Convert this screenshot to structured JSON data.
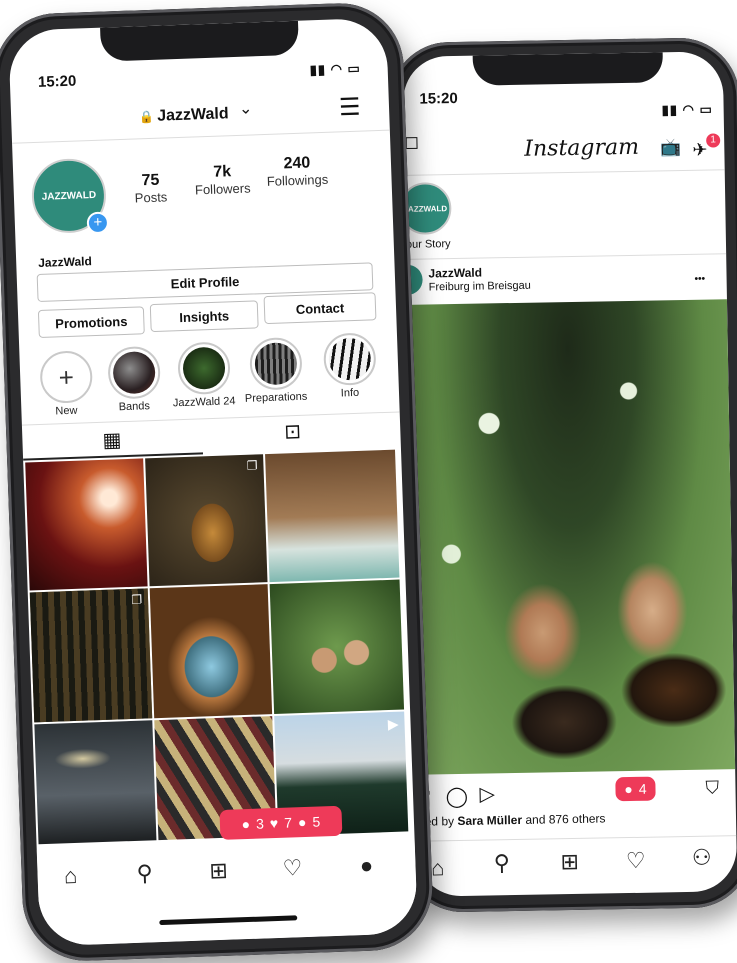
{
  "left_phone": {
    "status_time": "15:20",
    "status_icons": "▮▮▮ ◠ ▭",
    "account": "JazzWald",
    "account_chevron": "⌄",
    "menu_icon": "☰",
    "avatar_text": "JAZZWALD",
    "stats": [
      {
        "value": "75",
        "label": "Posts"
      },
      {
        "value": "7k",
        "label": "Followers"
      },
      {
        "value": "240",
        "label": "Followings"
      }
    ],
    "profile_name": "JazzWald",
    "edit_profile": "Edit Profile",
    "buttons": [
      "Promotions",
      "Insights",
      "Contact"
    ],
    "highlights": [
      "New",
      "Bands",
      "JazzWald 24",
      "Preparations",
      "Info"
    ],
    "notification": {
      "comments": "3",
      "likes": "7",
      "follows": "5"
    },
    "nav_icons": [
      "home-icon",
      "search-icon",
      "add-icon",
      "heart-icon",
      "profile-icon"
    ]
  },
  "right_phone": {
    "status_time": "15:20",
    "app_title": "Instagram",
    "dm_badge": "1",
    "story_label": "our Story",
    "story_avatar_text": "JAZZWALD",
    "post_user": "JazzWald",
    "post_location": "Freiburg im Breisgau",
    "post_more": "•••",
    "comment_badge": "4",
    "liked_prefix": "iked by ",
    "liked_name": "Sara Müller",
    "liked_suffix": " and 876 others",
    "nav_icons": [
      "home-icon",
      "search-icon",
      "add-icon",
      "heart-icon",
      "profile-icon"
    ]
  },
  "colors": {
    "brand_teal": "#2f8b7b",
    "notification_red": "#ee3a59",
    "phone_body": "#2b2b2d"
  }
}
